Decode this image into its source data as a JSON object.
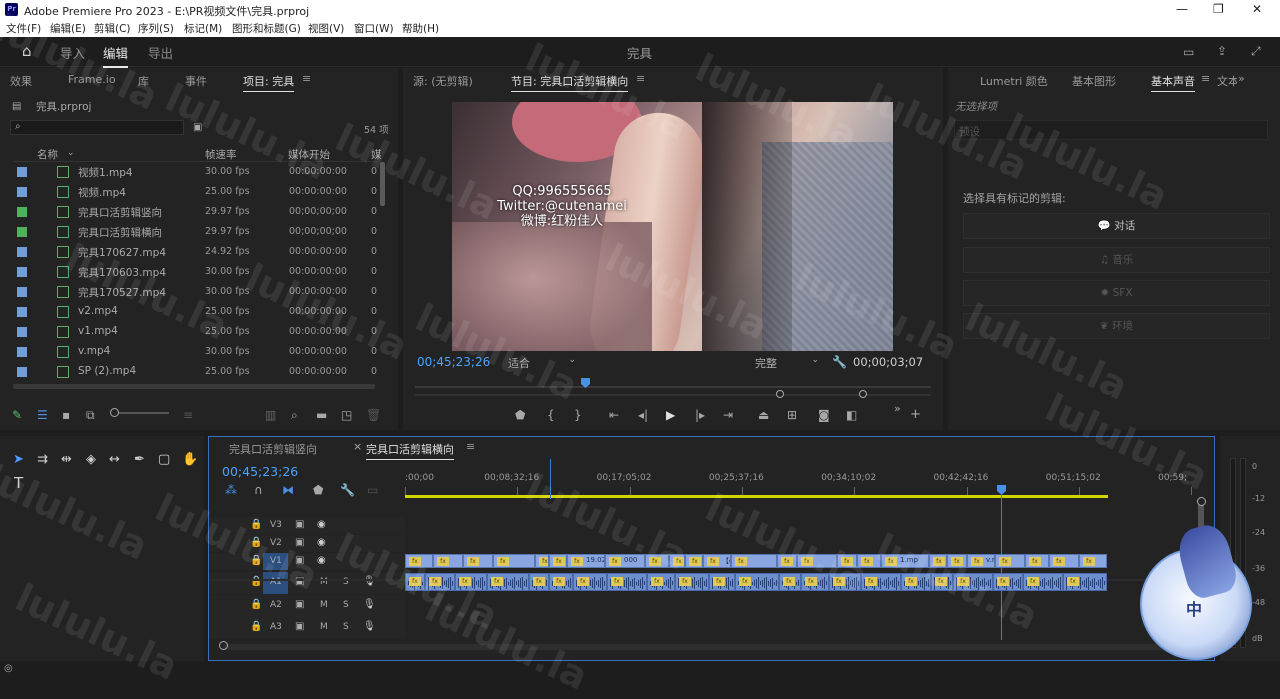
{
  "window": {
    "title": "Adobe Premiere Pro 2023 - E:\\PR视频文件\\完具.prproj",
    "logo": "Pr"
  },
  "menu": [
    "文件(F)",
    "编辑(E)",
    "剪辑(C)",
    "序列(S)",
    "标记(M)",
    "图形和标题(G)",
    "视图(V)",
    "窗口(W)",
    "帮助(H)"
  ],
  "workspace": {
    "tabs": [
      "导入",
      "编辑",
      "导出"
    ],
    "active": "编辑",
    "center_title": "完具"
  },
  "project": {
    "tabs": [
      "效果",
      "Frame.io",
      "库",
      "事件",
      "项目: 完具"
    ],
    "file": "完具.prproj",
    "item_count": "54 项",
    "columns": [
      "名称",
      "帧速率",
      "媒体开始",
      "媒"
    ],
    "items": [
      {
        "name": "视频1.mp4",
        "fps": "30.00 fps",
        "start": "00:00:00:00",
        "ex": "0",
        "color": "#6f9fd6",
        "kind": "clip"
      },
      {
        "name": "视频.mp4",
        "fps": "25.00 fps",
        "start": "00:00:00:00",
        "ex": "0",
        "color": "#6f9fd6",
        "kind": "clip"
      },
      {
        "name": "完具口活剪辑竖向",
        "fps": "29.97 fps",
        "start": "00;00;00;00",
        "ex": "0",
        "color": "#4cb45a",
        "kind": "seq"
      },
      {
        "name": "完具口活剪辑横向",
        "fps": "29.97 fps",
        "start": "00;00;00;00",
        "ex": "0",
        "color": "#4cb45a",
        "kind": "seq"
      },
      {
        "name": "完具170627.mp4",
        "fps": "24.92 fps",
        "start": "00:00:00:00",
        "ex": "0",
        "color": "#6f9fd6",
        "kind": "clip"
      },
      {
        "name": "完具170603.mp4",
        "fps": "30.00 fps",
        "start": "00:00:00:00",
        "ex": "0",
        "color": "#6f9fd6",
        "kind": "clip"
      },
      {
        "name": "完具170527.mp4",
        "fps": "30.00 fps",
        "start": "00:00:00:00",
        "ex": "0",
        "color": "#6f9fd6",
        "kind": "clip"
      },
      {
        "name": "v2.mp4",
        "fps": "25.00 fps",
        "start": "00:00:00:00",
        "ex": "0",
        "color": "#6f9fd6",
        "kind": "clip"
      },
      {
        "name": "v1.mp4",
        "fps": "25.00 fps",
        "start": "00:00:00:00",
        "ex": "0",
        "color": "#6f9fd6",
        "kind": "clip"
      },
      {
        "name": "v.mp4",
        "fps": "30.00 fps",
        "start": "00:00:00:00",
        "ex": "0",
        "color": "#6f9fd6",
        "kind": "clip"
      },
      {
        "name": "SP (2).mp4",
        "fps": "25.00 fps",
        "start": "00:00:00:00",
        "ex": "0",
        "color": "#6f9fd6",
        "kind": "clip"
      }
    ]
  },
  "monitor": {
    "source_tab": "源: (无剪辑)",
    "program_tab": "节目: 完具口活剪辑横向",
    "overlay_text": [
      "QQ:996555665",
      "Twitter:@cutenamei",
      "微博:红粉佳人"
    ],
    "timecode": "00;45;23;26",
    "fit": "适合",
    "quality": "完整",
    "duration": "00;00;03;07"
  },
  "essential_sound": {
    "tabs": [
      "Lumetri 颜色",
      "基本图形",
      "基本声音",
      "文本"
    ],
    "no_selection": "无选择项",
    "preset": "预设",
    "prompt": "选择具有标记的剪辑:",
    "buttons": [
      "对话",
      "音乐",
      "SFX",
      "环境"
    ]
  },
  "timeline": {
    "tabs": [
      "完具口活剪辑竖向",
      "完具口活剪辑横向"
    ],
    "timecode": "00;45;23;26",
    "ruler": [
      ":00;00",
      "00;08;32;16",
      "00;17;05;02",
      "00;25;37;16",
      "00;34;10;02",
      "00;42;42;16",
      "00;51;15;02",
      "00;59;"
    ],
    "video_tracks": [
      "V3",
      "V2",
      "V1"
    ],
    "audio_tracks": [
      "A1",
      "A2",
      "A3"
    ],
    "track_buttons": {
      "mute": "M",
      "solo": "S"
    },
    "clip_labels": [
      "19.02.22",
      "000",
      "【cy",
      "1.m",
      "1.mp",
      "v.mp4 [",
      "【cychd.top】04"
    ],
    "fx": "fx"
  },
  "meter": {
    "labels": [
      "0",
      "-12",
      "-24",
      "-36",
      "-48",
      "dB"
    ]
  },
  "watermark": "lululu.la",
  "badge": "中"
}
